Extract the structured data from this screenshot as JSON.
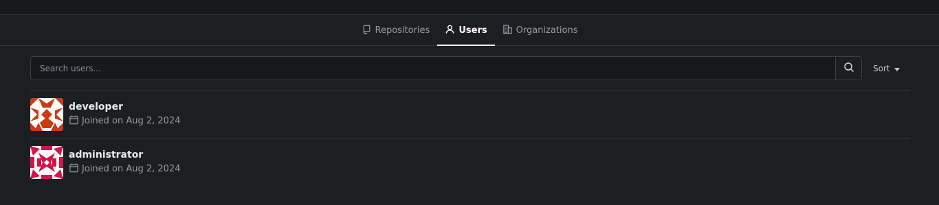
{
  "tabs": [
    {
      "label": "Repositories",
      "icon": "repo-icon"
    },
    {
      "label": "Users",
      "icon": "person-icon",
      "active": true
    },
    {
      "label": "Organizations",
      "icon": "organization-icon"
    }
  ],
  "search": {
    "placeholder": "Search users...",
    "value": ""
  },
  "sort": {
    "label": "Sort"
  },
  "users": [
    {
      "name": "developer",
      "joined": "Joined on Aug 2, 2024",
      "avatar_color": "#cc3a0f"
    },
    {
      "name": "administrator",
      "joined": "Joined on Aug 2, 2024",
      "avatar_color": "#d31447"
    }
  ]
}
